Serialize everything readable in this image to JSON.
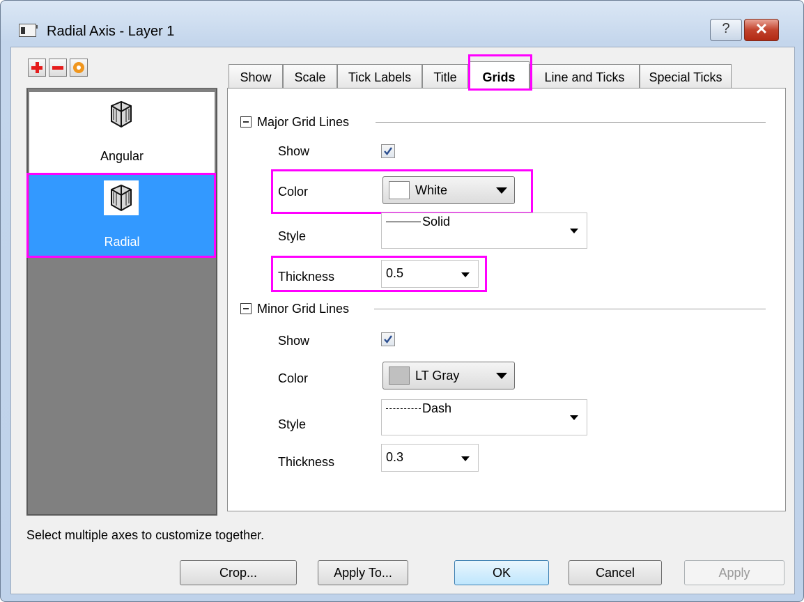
{
  "window": {
    "title": "Radial Axis - Layer 1",
    "help_label": "?",
    "close_label": "✕"
  },
  "toolbar": {
    "add_icon": "plus-icon",
    "remove_icon": "minus-icon",
    "reset_icon": "circle-icon"
  },
  "axis_list": {
    "items": [
      {
        "label": "Angular",
        "selected": false
      },
      {
        "label": "Radial",
        "selected": true
      }
    ]
  },
  "tabs": [
    {
      "label": "Show"
    },
    {
      "label": "Scale"
    },
    {
      "label": "Tick Labels"
    },
    {
      "label": "Title"
    },
    {
      "label": "Grids",
      "active": true
    },
    {
      "label": "Line and Ticks"
    },
    {
      "label": "Special Ticks"
    }
  ],
  "major": {
    "header": "Major Grid Lines",
    "show_label": "Show",
    "show_checked": true,
    "color_label": "Color",
    "color_value": "White",
    "color_swatch": "#ffffff",
    "style_label": "Style",
    "style_value": "Solid",
    "thickness_label": "Thickness",
    "thickness_value": "0.5"
  },
  "minor": {
    "header": "Minor Grid Lines",
    "show_label": "Show",
    "show_checked": true,
    "color_label": "Color",
    "color_value": "LT Gray",
    "color_swatch": "#c0c0c0",
    "style_label": "Style",
    "style_value": "Dash",
    "thickness_label": "Thickness",
    "thickness_value": "0.3"
  },
  "status_text": "Select multiple axes to customize together.",
  "buttons": {
    "crop": "Crop...",
    "apply_to": "Apply To...",
    "ok": "OK",
    "cancel": "Cancel",
    "apply": "Apply"
  },
  "colors": {
    "highlight": "#ff00ff",
    "selection": "#3399ff"
  }
}
